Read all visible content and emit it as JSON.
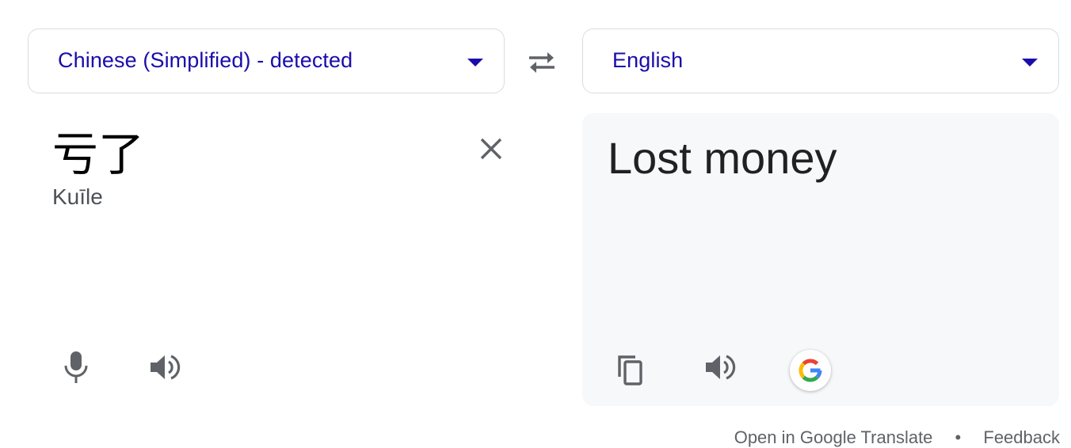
{
  "source": {
    "language": "Chinese (Simplified) - detected",
    "text": "亏了",
    "romanization": "Kuīle"
  },
  "target": {
    "language": "English",
    "text": "Lost money"
  },
  "icons": {
    "source_dropdown": "chevron-down-icon",
    "target_dropdown": "chevron-down-icon",
    "swap": "swap-languages-icon",
    "clear": "close-icon",
    "mic": "microphone-icon",
    "source_speaker": "speaker-icon",
    "copy": "copy-icon",
    "target_speaker": "speaker-icon",
    "google": "google-logo-icon"
  },
  "colors": {
    "link": "#1a0dab",
    "icon": "#5f6368",
    "panel_bg": "#f7f8fa",
    "border": "#dadce0"
  },
  "footer": {
    "open_link": "Open in Google Translate",
    "separator": "•",
    "feedback": "Feedback"
  }
}
